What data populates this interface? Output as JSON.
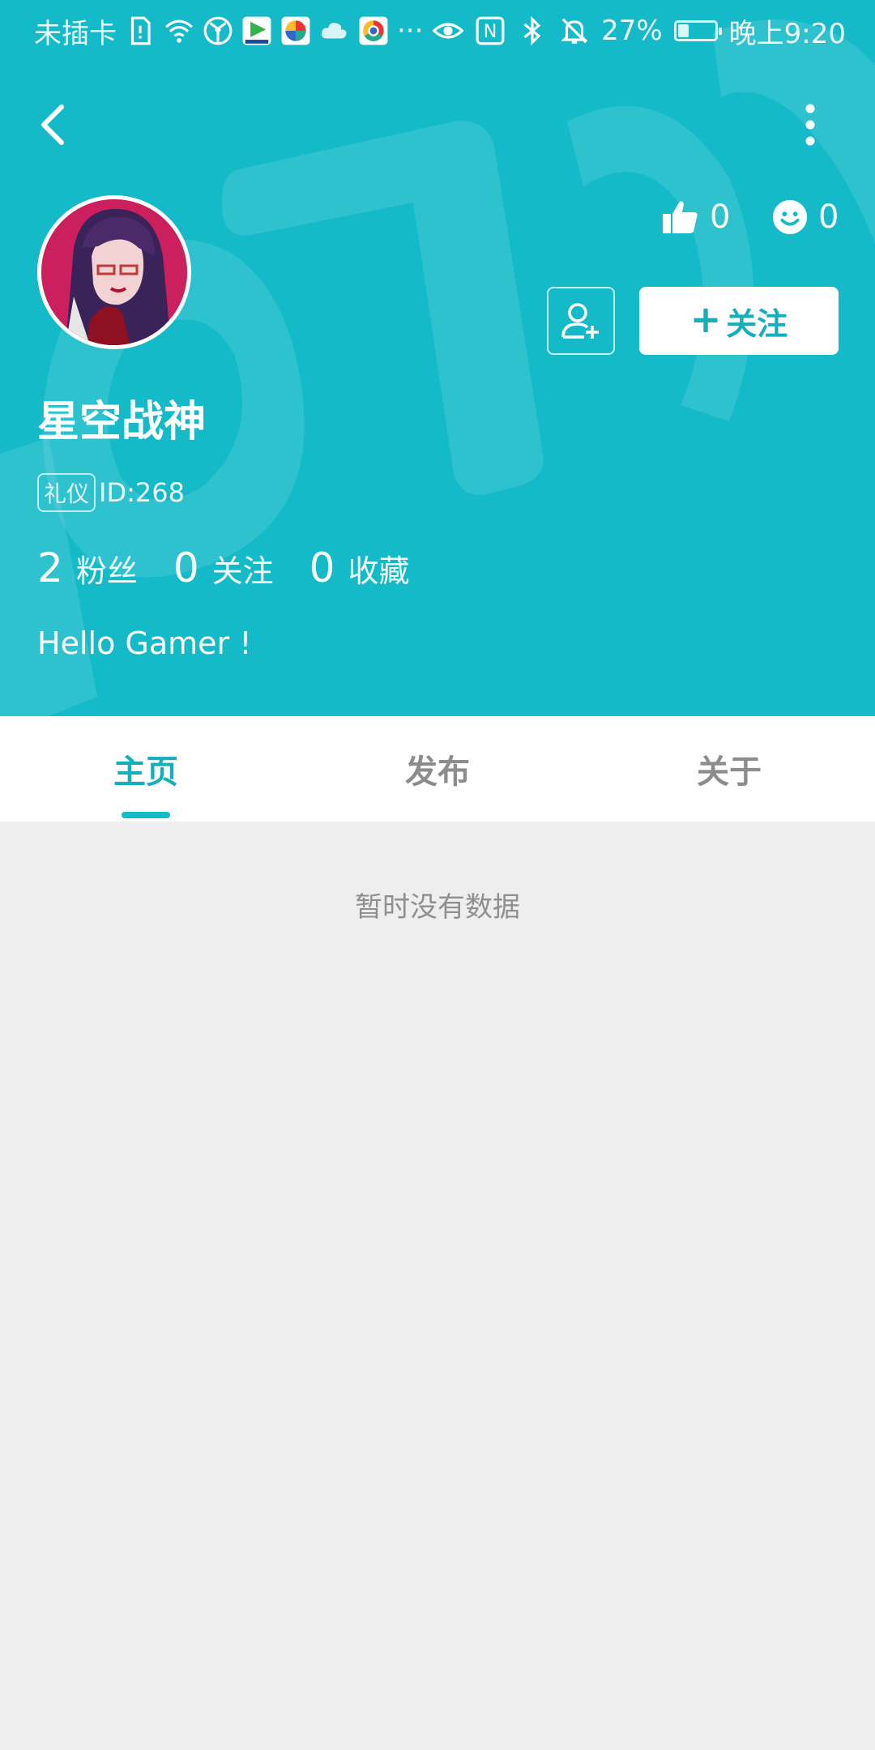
{
  "status_bar": {
    "carrier": "未插卡",
    "battery_percent": "27%",
    "battery_level": 0.27,
    "time": "晚上9:20",
    "more": "···",
    "nfc": "N"
  },
  "nav": {
    "back_icon": "chevron-left-icon",
    "more_icon": "more-vertical-icon"
  },
  "profile": {
    "username": "星空战神",
    "role_badge": "礼仪",
    "id_text": "ID:268",
    "likes": "0",
    "smiles": "0",
    "follow_label": "关注",
    "follow_plus": "+",
    "counts": [
      {
        "value": "2",
        "label": "粉丝"
      },
      {
        "value": "0",
        "label": "关注"
      },
      {
        "value": "0",
        "label": "收藏"
      }
    ],
    "bio": "Hello Gamer !"
  },
  "tabs": [
    {
      "label": "主页",
      "active": true
    },
    {
      "label": "发布",
      "active": false
    },
    {
      "label": "关于",
      "active": false
    }
  ],
  "empty_message": "暂时没有数据",
  "colors": {
    "header": "#15bac8",
    "accent": "#15aebc",
    "background": "#eeeeee"
  }
}
